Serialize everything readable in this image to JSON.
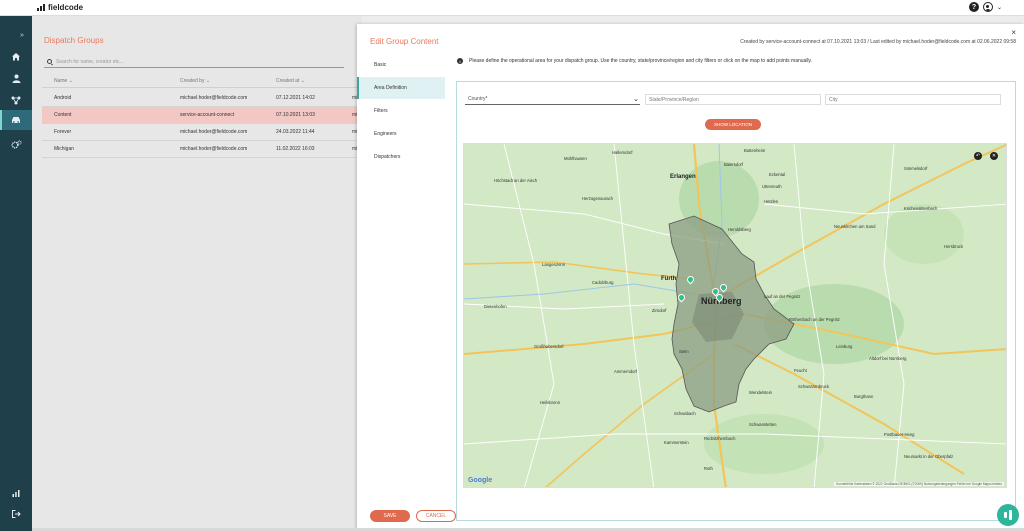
{
  "app": {
    "brand": "fieldcode",
    "help_label": "?"
  },
  "nav": {
    "expand_label": "»",
    "items": [
      {
        "name": "home",
        "icon": "home-icon"
      },
      {
        "name": "users",
        "icon": "person-icon"
      },
      {
        "name": "workflow",
        "icon": "network-icon"
      },
      {
        "name": "dispatch",
        "icon": "car-icon"
      },
      {
        "name": "settings",
        "icon": "gears-icon"
      }
    ]
  },
  "groups": {
    "title": "Dispatch Groups",
    "search_placeholder": "Search for name, creator etc...",
    "columns": [
      "Name",
      "Created by",
      "Created at"
    ],
    "rows": [
      {
        "name": "Android",
        "created_by": "michael.hoder@fieldcode.com",
        "created_at": "07.12.2021 14:02",
        "extra": "mi"
      },
      {
        "name": "Content",
        "created_by": "service-account-connect",
        "created_at": "07.10.2021 13:03",
        "extra": "mi"
      },
      {
        "name": "Forever",
        "created_by": "michael.hoder@fieldcode.com",
        "created_at": "24.03.2022 11:44",
        "extra": "mi"
      },
      {
        "name": "Michigan",
        "created_by": "michael.hoder@fieldcode.com",
        "created_at": "11.02.2022 16:03",
        "extra": "mi"
      }
    ]
  },
  "modal": {
    "title": "Edit Group Content",
    "close": "×",
    "meta": "Created by service-account-connect at 07.10.2021 13:03 / Last edited by michael.hoder@fieldcode.com at 02.06.2022 09:58",
    "menu": [
      "Basic",
      "Area Definition",
      "Filters",
      "Engineers",
      "Dispatchers"
    ],
    "info_icon": "i",
    "info": "Please define the operational area for your dispatch group. Use the country, state/province/region and city filters or click on the map to add points manually.",
    "country_label": "Country*",
    "state_placeholder": "State/Province/Region",
    "city_placeholder": "City",
    "show_location": "SHOW LOCATION",
    "save": "SAVE",
    "cancel": "CANCEL"
  },
  "map": {
    "google": "Google",
    "attribution": "Kurzbefehle     Kartendaten © 2022 GeoBasis-DE/BKG (©2009)     Nutzungsbedingungen     Fehler bei Google Maps melden",
    "labels": [
      {
        "t": "Nürnberg",
        "cls": "huge"
      },
      {
        "t": "Erlangen",
        "cls": "big"
      },
      {
        "t": "Fürth",
        "cls": "big"
      },
      {
        "t": "Buttenheim",
        "cls": ""
      },
      {
        "t": "Hallerndorf",
        "cls": ""
      },
      {
        "t": "Mühlhausen",
        "cls": ""
      },
      {
        "t": "Höchstadt an der Aisch",
        "cls": ""
      },
      {
        "t": "Herzogenaurach",
        "cls": ""
      },
      {
        "t": "Heroldsberg",
        "cls": ""
      },
      {
        "t": "Lauf an der Pegnitz",
        "cls": ""
      },
      {
        "t": "Langenzenn",
        "cls": ""
      },
      {
        "t": "Zirndorf",
        "cls": ""
      },
      {
        "t": "Stein",
        "cls": ""
      },
      {
        "t": "Schwabach",
        "cls": ""
      },
      {
        "t": "Feucht",
        "cls": ""
      },
      {
        "t": "Altdorf bei Nürnberg",
        "cls": ""
      },
      {
        "t": "Roth",
        "cls": ""
      },
      {
        "t": "Heilsbronn",
        "cls": ""
      },
      {
        "t": "Wendelstein",
        "cls": ""
      },
      {
        "t": "Burgthann",
        "cls": ""
      },
      {
        "t": "Neumarkt in der Oberpfalz",
        "cls": ""
      },
      {
        "t": "Hersbruck",
        "cls": ""
      },
      {
        "t": "Kammerstein",
        "cls": ""
      },
      {
        "t": "Rednitzhembach",
        "cls": ""
      },
      {
        "t": "Schwanstetten",
        "cls": ""
      },
      {
        "t": "Eckental",
        "cls": ""
      },
      {
        "t": "Röthenbach an der Pegnitz",
        "cls": ""
      },
      {
        "t": "Schwarzenbruck",
        "cls": ""
      },
      {
        "t": "Cadolzburg",
        "cls": ""
      },
      {
        "t": "Großhabersdorf",
        "cls": ""
      },
      {
        "t": "Dietenhofen",
        "cls": ""
      },
      {
        "t": "Ammerndorf",
        "cls": ""
      },
      {
        "t": "Postbauer-Heng",
        "cls": ""
      },
      {
        "t": "Leinburg",
        "cls": ""
      },
      {
        "t": "Kirchensittenbach",
        "cls": ""
      },
      {
        "t": "Neunkirchen am Sand",
        "cls": ""
      },
      {
        "t": "Simmelsdorf",
        "cls": ""
      },
      {
        "t": "Hetzles",
        "cls": ""
      },
      {
        "t": "Baiersdorf",
        "cls": ""
      },
      {
        "t": "Uttenreuth",
        "cls": ""
      }
    ]
  }
}
